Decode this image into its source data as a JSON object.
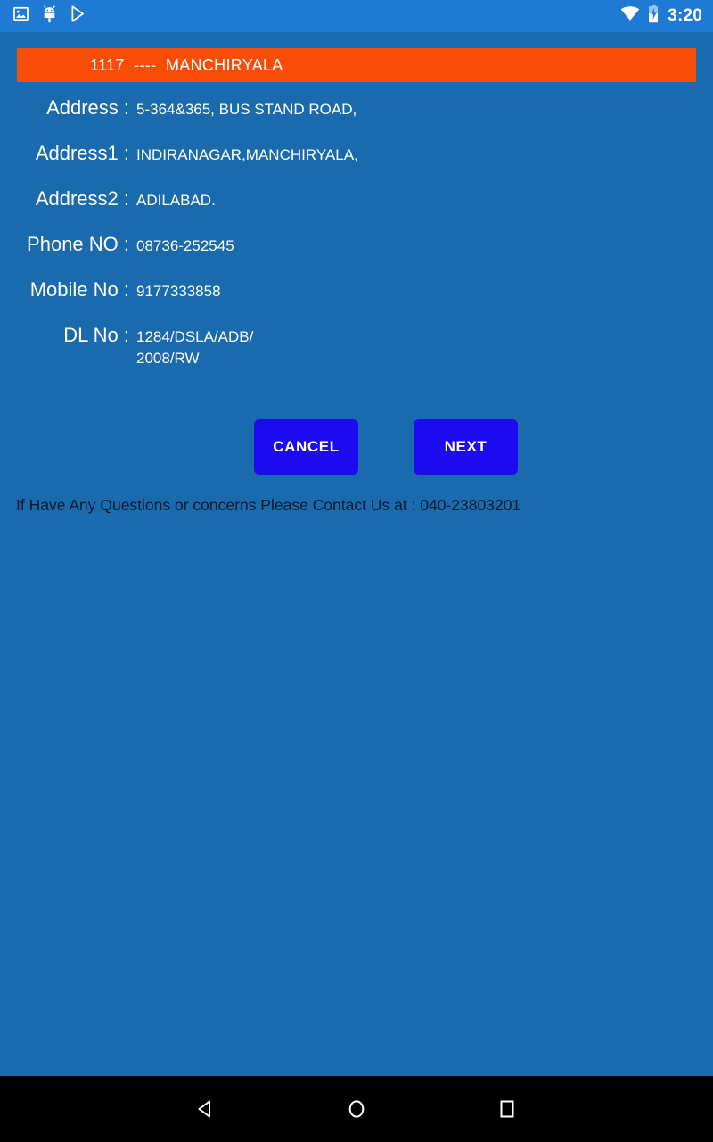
{
  "statusbar": {
    "left_icons": [
      "image-icon",
      "android-robot-icon",
      "play-store-icon"
    ],
    "right_icons": [
      "wifi-icon",
      "battery-charging-icon"
    ],
    "clock": "3:20",
    "background_color": "#1f7ad4"
  },
  "banner": {
    "text": "1117  ----  MANCHIRYALA",
    "background_color": "#f84c09",
    "text_color": "#ffffff"
  },
  "details": {
    "rows": [
      {
        "label": "Address :",
        "value": "5-364&365, BUS STAND ROAD,"
      },
      {
        "label": "Address1 :",
        "value": "INDIRANAGAR,MANCHIRYALA,"
      },
      {
        "label": "Address2 :",
        "value": "ADILABAD."
      },
      {
        "label": "Phone NO :",
        "value": "08736-252545"
      },
      {
        "label": "Mobile No :",
        "value": "9177333858"
      },
      {
        "label": "DL No :",
        "value": "1284/DSLA/ADB/\n2008/RW"
      }
    ]
  },
  "buttons": {
    "cancel_label": "CANCEL",
    "next_label": "NEXT",
    "color": "#1b0bee"
  },
  "footer": {
    "text": "If Have Any Questions or concerns Please Contact Us at : 040-23803201",
    "text_color": "#0a1a2e"
  },
  "navbar": {
    "back": "back-triangle-icon",
    "home": "home-circle-icon",
    "recents": "recents-square-icon",
    "background_color": "#000000"
  },
  "page": {
    "background_color": "#1a6bad"
  }
}
